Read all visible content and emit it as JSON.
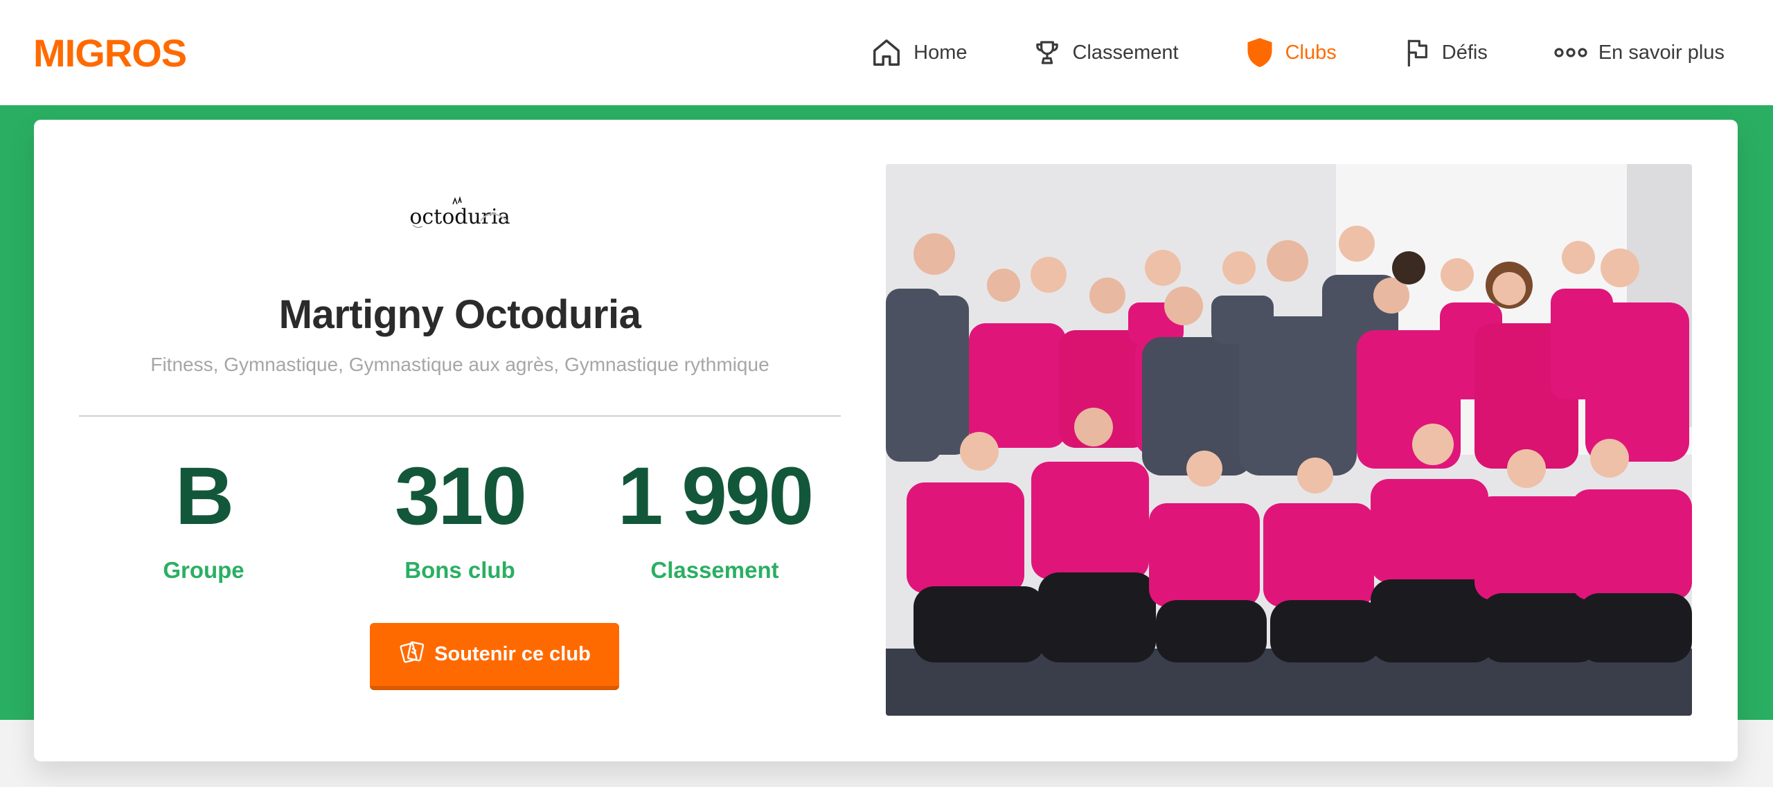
{
  "header": {
    "logo": "MIGROS",
    "nav": [
      {
        "label": "Home",
        "icon": "home-icon",
        "active": false
      },
      {
        "label": "Classement",
        "icon": "trophy-icon",
        "active": false
      },
      {
        "label": "Clubs",
        "icon": "shield-icon",
        "active": true
      },
      {
        "label": "Défis",
        "icon": "flag-icon",
        "active": false
      },
      {
        "label": "En savoir plus",
        "icon": "more-dots-icon",
        "active": false
      }
    ]
  },
  "club": {
    "logo_text": "octoduria",
    "name": "Martigny Octoduria",
    "categories": "Fitness, Gymnastique, Gymnastique aux agrès, Gymnastique rythmique",
    "stats": [
      {
        "value": "B",
        "label": "Groupe"
      },
      {
        "value": "310",
        "label": "Bons club"
      },
      {
        "value": "1 990",
        "label": "Classement"
      }
    ],
    "support_button": "Soutenir ce club",
    "photo": "team-photo"
  },
  "colors": {
    "brand_orange": "#ff6a00",
    "green": "#2aaf62",
    "dark_green": "#13573a"
  }
}
